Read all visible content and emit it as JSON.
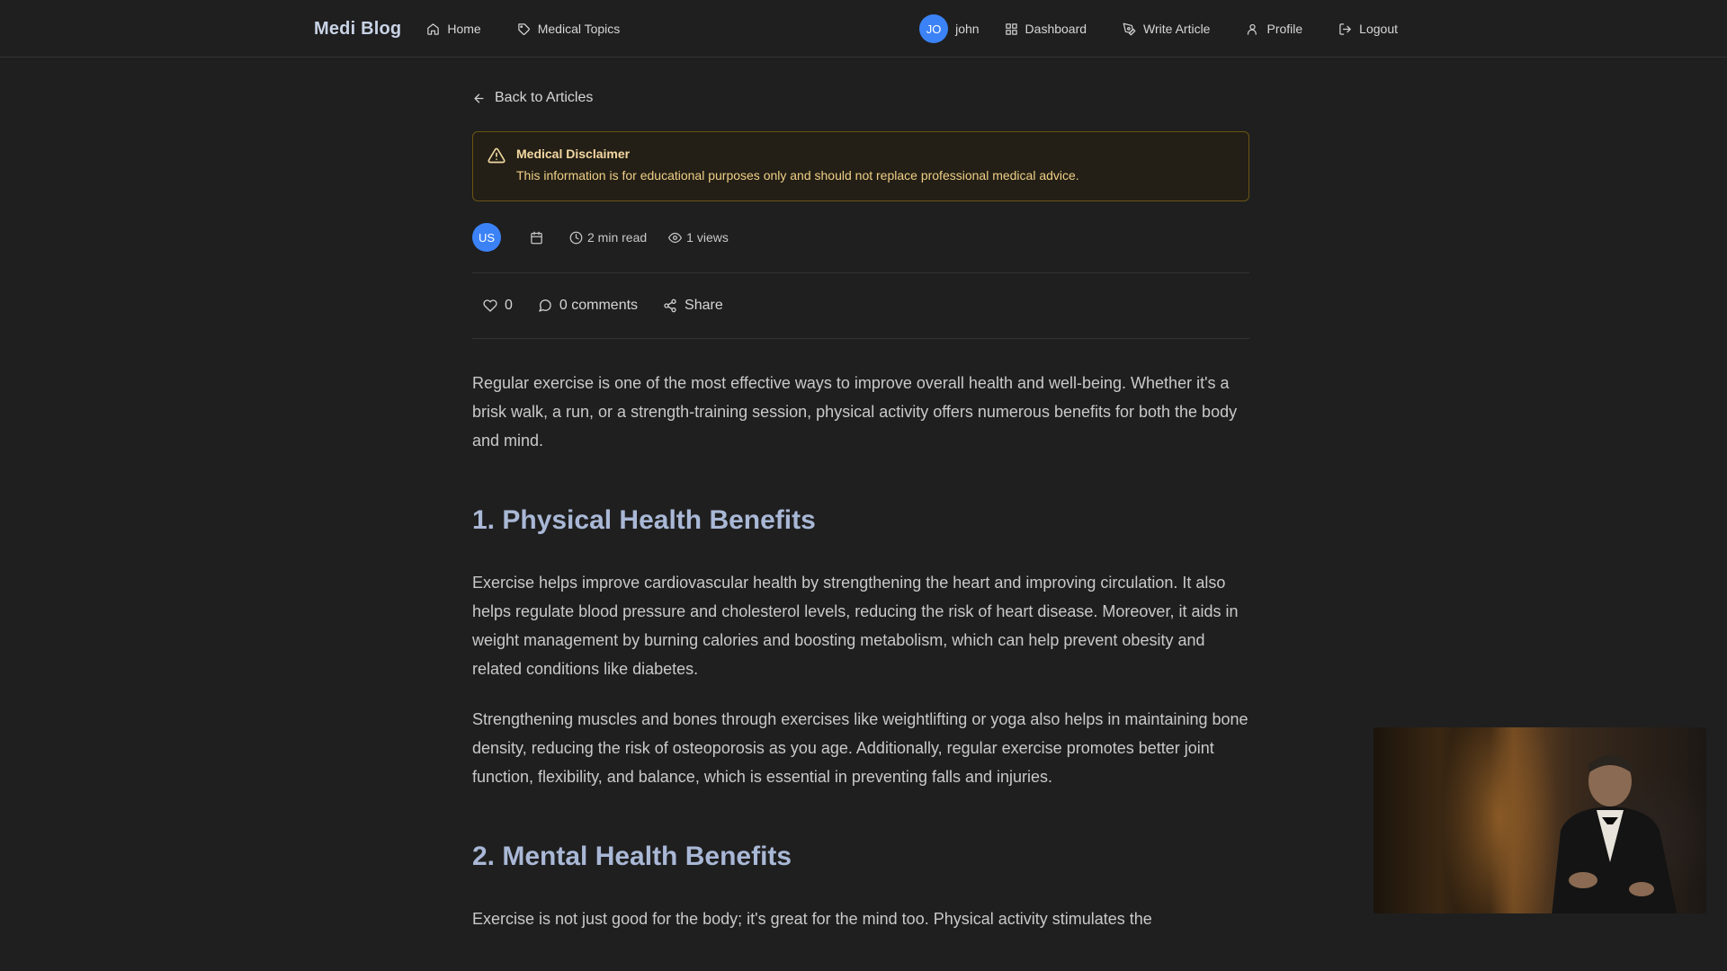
{
  "navbar": {
    "brand": "Medi Blog",
    "links": [
      {
        "label": "Home",
        "icon": "home-icon"
      },
      {
        "label": "Medical Topics",
        "icon": "tag-icon"
      }
    ],
    "user": {
      "initials": "JO",
      "name": "john"
    },
    "right_links": [
      {
        "label": "Dashboard",
        "icon": "grid-icon"
      },
      {
        "label": "Write Article",
        "icon": "pen-icon"
      },
      {
        "label": "Profile",
        "icon": "user-icon"
      },
      {
        "label": "Logout",
        "icon": "logout-icon"
      }
    ]
  },
  "back_link": "Back to Articles",
  "disclaimer": {
    "title": "Medical Disclaimer",
    "text": "This information is for educational purposes only and should not replace professional medical advice."
  },
  "meta": {
    "author_initials": "US",
    "read_time": "2 min read",
    "views": "1 views"
  },
  "actions": {
    "likes": "0",
    "comments": "0 comments",
    "share": "Share"
  },
  "article": {
    "intro": "Regular exercise is one of the most effective ways to improve overall health and well-being. Whether it's a brisk walk, a run, or a strength-training session, physical activity offers numerous benefits for both the body and mind.",
    "h1": "1. Physical Health Benefits",
    "p1": "Exercise helps improve cardiovascular health by strengthening the heart and improving circulation. It also helps regulate blood pressure and cholesterol levels, reducing the risk of heart disease. Moreover, it aids in weight management by burning calories and boosting metabolism, which can help prevent obesity and related conditions like diabetes.",
    "p2": "Strengthening muscles and bones through exercises like weightlifting or yoga also helps in maintaining bone density, reducing the risk of osteoporosis as you age. Additionally, regular exercise promotes better joint function, flexibility, and balance, which is essential in preventing falls and injuries.",
    "h2": "2. Mental Health Benefits",
    "p3": "Exercise is not just good for the body; it's great for the mind too. Physical activity stimulates the"
  },
  "colors": {
    "background": "#1f1f1f",
    "accent": "#3b82f6",
    "heading": "#a9b8d6",
    "warning_border": "#6b5413",
    "warning_text": "#f0cf86"
  }
}
